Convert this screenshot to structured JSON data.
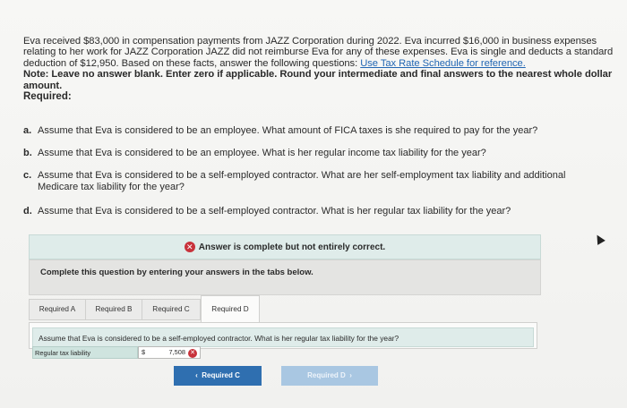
{
  "intro": {
    "text": "Eva received $83,000 in compensation payments from JAZZ Corporation during 2022. Eva incurred $16,000 in business expenses relating to her work for JAZZ Corporation JAZZ did not reimburse Eva for any of these expenses. Eva is single and deducts a standard deduction of $12,950. Based on these facts, answer the following questions: ",
    "link": "Use Tax Rate Schedule for reference.",
    "note": "Note: Leave no answer blank. Enter zero if applicable. Round your intermediate and final answers to the nearest whole dollar amount."
  },
  "required_title": "Required:",
  "questions": [
    {
      "letter": "a.",
      "text": "Assume that Eva is considered to be an employee. What amount of FICA taxes is she required to pay for the year?"
    },
    {
      "letter": "b.",
      "text": "Assume that Eva is considered to be an employee. What is her regular income tax liability for the year?"
    },
    {
      "letter": "c.",
      "text": "Assume that Eva is considered to be a self-employed contractor. What are her self-employment tax liability and additional Medicare tax liability for the year?"
    },
    {
      "letter": "d.",
      "text": "Assume that Eva is considered to be a self-employed contractor. What is her regular tax liability for the year?"
    }
  ],
  "banner": {
    "text": "Answer is complete but not entirely correct."
  },
  "instruction": "Complete this question by entering your answers in the tabs below.",
  "tabs": [
    "Required A",
    "Required B",
    "Required C",
    "Required D"
  ],
  "panel": {
    "question": "Assume that Eva is considered to be a self-employed contractor. What is her regular tax liability for the year?",
    "row_label": "Regular tax liability",
    "currency": "$",
    "value": "7,508"
  },
  "nav": {
    "prev": "Required C",
    "next": "Required D"
  },
  "colors": {
    "accent": "#2f6fb0",
    "error": "#c8323b",
    "banner_bg": "#dfecea"
  }
}
